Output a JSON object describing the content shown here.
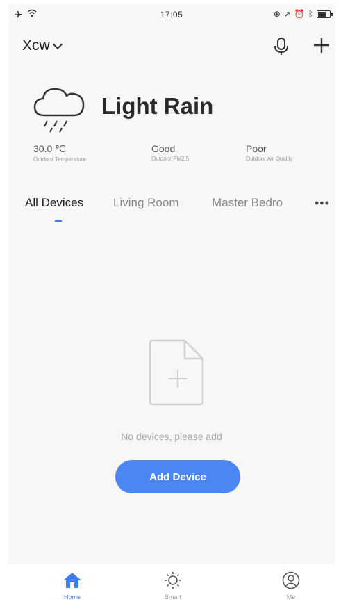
{
  "status_bar": {
    "time": "17:05"
  },
  "header": {
    "home_name": "Xcw",
    "icons": [
      "mic-icon",
      "plus-icon",
      "chevron-down-icon"
    ]
  },
  "weather": {
    "condition": "Light Rain",
    "icon": "light-rain-cloud-icon",
    "metrics": [
      {
        "value": "30.0 ℃",
        "label": "Outdoor Temperature"
      },
      {
        "value": "Good",
        "label": "Outdoor PM2.5"
      },
      {
        "value": "Poor",
        "label": "Outdoor Air Quality"
      }
    ]
  },
  "tabs": {
    "items": [
      "All Devices",
      "Living Room",
      "Master Bedro"
    ],
    "active": "All Devices",
    "more": "•••"
  },
  "empty_state": {
    "icon": "add-file-icon",
    "message": "No devices, please add",
    "button_label": "Add Device"
  },
  "bottom_nav": {
    "items": [
      {
        "label": "Home",
        "icon": "home-icon"
      },
      {
        "label": "Smart",
        "icon": "smart-sun-icon"
      },
      {
        "label": "Me",
        "icon": "user-icon"
      }
    ],
    "active": "Home"
  },
  "colors": {
    "accent": "#4b86f2",
    "background": "#f7f7f7"
  }
}
